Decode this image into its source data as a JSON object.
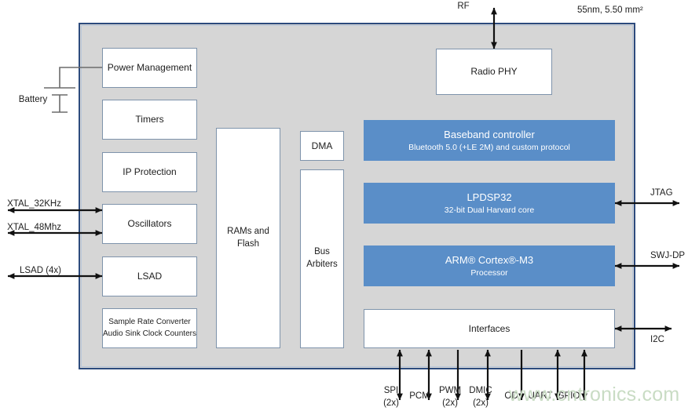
{
  "diagram": {
    "process_note": "55nm, 5.50 mm²",
    "watermark": "www.cntronics.com",
    "power_source_label": "Battery",
    "rf_label": "RF"
  },
  "blocks": {
    "power_management": {
      "title": "Power Management"
    },
    "timers": {
      "title": "Timers"
    },
    "ip_protection": {
      "title": "IP Protection"
    },
    "oscillators": {
      "title": "Oscillators"
    },
    "lsad": {
      "title": "LSAD"
    },
    "sample_rate_converter": {
      "line1": "Sample Rate Converter",
      "line2": "Audio Sink Clock Counters"
    },
    "rams_and_flash": {
      "line1": "RAMs and",
      "line2": "Flash"
    },
    "dma": {
      "title": "DMA"
    },
    "bus_arbiters": {
      "line1": "Bus",
      "line2": "Arbiters"
    },
    "radio_phy": {
      "title": "Radio PHY"
    },
    "baseband_controller": {
      "title": "Baseband controller",
      "subtitle": "Bluetooth 5.0 (+LE 2M) and custom protocol"
    },
    "lpdsp32": {
      "title": "LPDSP32",
      "subtitle": "32-bit Dual Harvard core"
    },
    "cortex_m3": {
      "title": "ARM® Cortex®-M3",
      "subtitle": "Processor"
    },
    "interfaces": {
      "title": "Interfaces"
    }
  },
  "left_pins": [
    {
      "label": "XTAL_32KHz",
      "direction": "bidirectional"
    },
    {
      "label": "XTAL_48Mhz",
      "direction": "bidirectional"
    },
    {
      "label": "LSAD (4x)",
      "direction": "bidirectional"
    }
  ],
  "right_pins": [
    {
      "label": "JTAG",
      "direction": "bidirectional"
    },
    {
      "label": "SWJ-DP",
      "direction": "bidirectional"
    },
    {
      "label": "I2C",
      "direction": "bidirectional"
    }
  ],
  "bottom_pins": [
    {
      "line1": "SPI",
      "line2": "(2x)",
      "direction": "bidirectional"
    },
    {
      "line1": "PCM",
      "line2": "",
      "direction": "bidirectional"
    },
    {
      "line1": "PWM",
      "line2": "(2x)",
      "direction": "out"
    },
    {
      "line1": "DMIC",
      "line2": "(2x)",
      "direction": "bidirectional"
    },
    {
      "line1": "OD",
      "line2": "",
      "direction": "out"
    },
    {
      "line1": "UART",
      "line2": "",
      "direction": "bidirectional"
    },
    {
      "line1": "GPIO",
      "line2": "",
      "direction": "bidirectional"
    }
  ],
  "colors": {
    "chip_fill": "#d6d6d6",
    "chip_border": "#2d4b7d",
    "block_fill": "#ffffff",
    "block_border": "#7e93ab",
    "accent_blue": "#5a8ec8",
    "text": "#1d1d1d",
    "watermark": "#c9dcc4"
  }
}
